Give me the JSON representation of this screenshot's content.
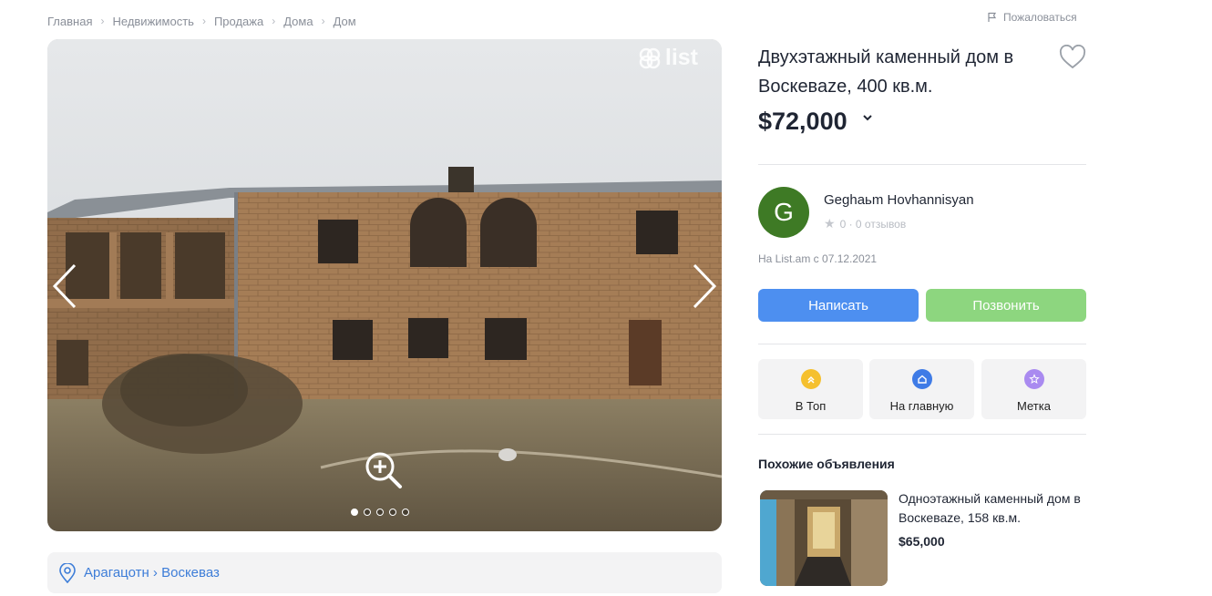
{
  "breadcrumb": [
    "Главная",
    "Недвижимость",
    "Продажа",
    "Дома",
    "Дом"
  ],
  "report_label": "Пожаловаться",
  "gallery": {
    "watermark": "list",
    "slide_count": 5,
    "active_slide": 1
  },
  "listing": {
    "title": "Двухэтажный каменный дом в Воскеваze, 400 кв.м.",
    "price": "$72,000",
    "location": "Арагацотн › Воскеваз"
  },
  "seller": {
    "initial": "G",
    "name": "Geghaьm Hovhannisyan",
    "rating": "0 · 0 отзывов",
    "since": "На List.am с 07.12.2021",
    "avatar_color": "#3e7a25"
  },
  "actions": {
    "write": "Написать",
    "call": "Позвонить"
  },
  "promotions": [
    {
      "label": "В Топ",
      "color": "#f5c02e"
    },
    {
      "label": "На главную",
      "color": "#3f7be6"
    },
    {
      "label": "Метка",
      "color": "#a98af0"
    }
  ],
  "similar": {
    "heading": "Похожие объявления",
    "items": [
      {
        "title": "Одноэтажный каменный дом в Воскеваze, 158 кв.м.",
        "price": "$65,000"
      }
    ]
  },
  "colors": {
    "accent_blue": "#4d8ff0",
    "accent_green": "#8dd67f",
    "link_blue": "#3d7dd8"
  }
}
